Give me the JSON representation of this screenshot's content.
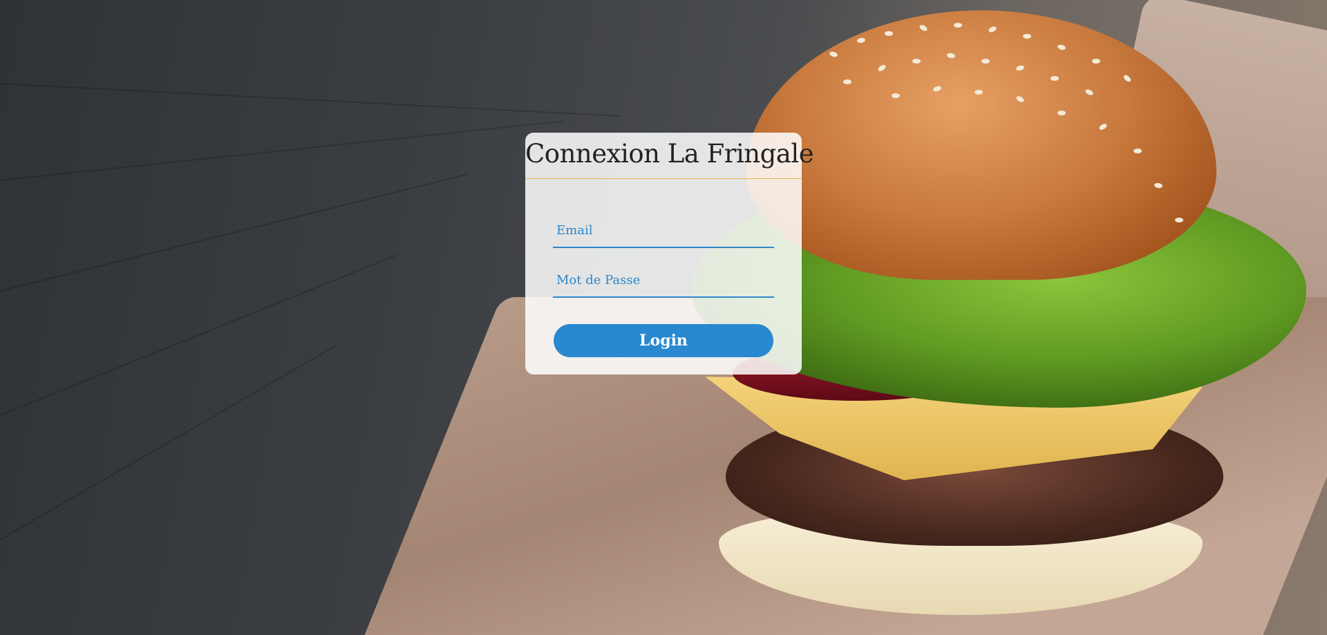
{
  "card": {
    "title": "Connexion La Fringale",
    "email_placeholder": "Email",
    "password_placeholder": "Mot de Passe",
    "login_label": "Login"
  },
  "colors": {
    "accent_blue": "#2a88d0",
    "divider_gold": "#e0b84a"
  }
}
